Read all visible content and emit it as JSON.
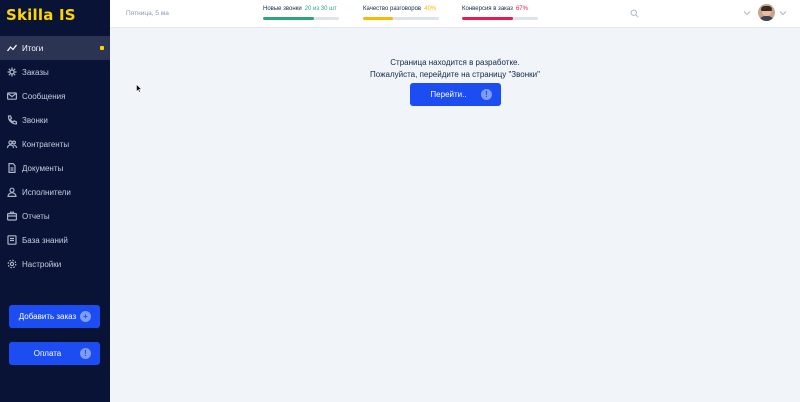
{
  "app": {
    "logo": "Skilla IS"
  },
  "sidebar": {
    "items": [
      {
        "label": "Итоги",
        "icon": "chart-line-icon",
        "active": true
      },
      {
        "label": "Заказы",
        "icon": "cog-box-icon"
      },
      {
        "label": "Сообщения",
        "icon": "mail-icon"
      },
      {
        "label": "Звонки",
        "icon": "phone-icon"
      },
      {
        "label": "Контрагенты",
        "icon": "users-icon"
      },
      {
        "label": "Документы",
        "icon": "document-icon"
      },
      {
        "label": "Исполнители",
        "icon": "person-icon"
      },
      {
        "label": "Отчеты",
        "icon": "briefcase-icon"
      },
      {
        "label": "База знаний",
        "icon": "book-icon"
      },
      {
        "label": "Настройки",
        "icon": "gear-icon"
      }
    ],
    "add_order_label": "Добавить заказ",
    "add_order_icon": "+",
    "payment_label": "Оплата",
    "payment_icon": "!"
  },
  "header": {
    "date": "Пятница, 5 ма",
    "stats": [
      {
        "label": "Новые звонки",
        "value": "20 из 30 шт",
        "color": "#28a879",
        "progress": 0.67
      },
      {
        "label": "Качество разговоров",
        "value": "40%",
        "color": "#ffb800",
        "progress": 0.4
      },
      {
        "label": "Конверсия в заказ",
        "value": "67%",
        "color": "#ea1a4f",
        "progress": 0.67
      }
    ]
  },
  "main": {
    "message_line1": "Страница находится в разработке.",
    "message_line2": "Пожалуйста, перейдите на страницу \"Звонки\"",
    "go_label": "Перейти..",
    "go_icon": "!"
  },
  "colors": {
    "sidebar_bg": "#091336",
    "accent": "#1b4df2",
    "logo": "#ffd500"
  }
}
